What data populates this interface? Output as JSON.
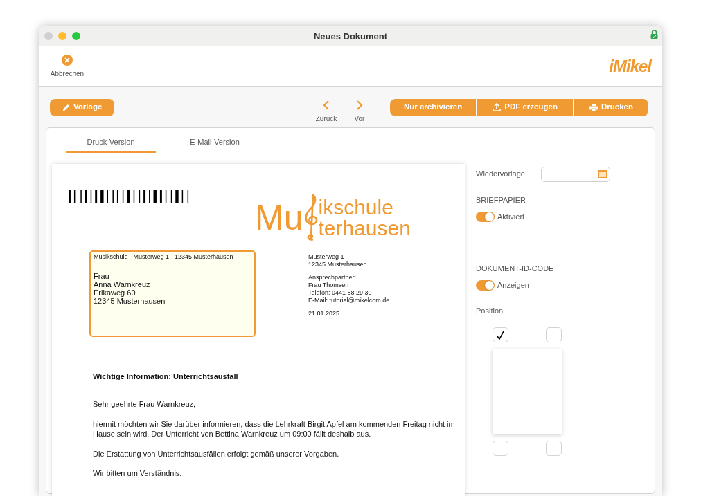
{
  "window": {
    "title": "Neues Dokument"
  },
  "toolbar": {
    "cancel": "Abbrechen",
    "brand": "iMikel"
  },
  "actions": {
    "template": "Vorlage",
    "back": "Zurück",
    "forward": "Vor",
    "buttons": [
      {
        "kind": "archive",
        "label": "Nur archivieren"
      },
      {
        "kind": "pdf",
        "label": "PDF erzeugen"
      },
      {
        "kind": "print",
        "label": "Drucken"
      }
    ]
  },
  "tabs": [
    {
      "label": "Druck-Version",
      "selected": true
    },
    {
      "label": "E-Mail-Version",
      "selected": false
    }
  ],
  "letter": {
    "logo": {
      "lead": "Mu",
      "line_1": "ikschule",
      "line_2": "terhausen"
    },
    "sender_line": "Musikschule - Musterweg 1 - 12345 Musterhausen",
    "recipient": [
      "Frau",
      "Anna Warnkreuz",
      "Erikaweg 60",
      "12345 Musterhausen"
    ],
    "info_blocks": [
      [
        "Musterweg 1",
        "12345 Musterhausen"
      ],
      [
        "Ansprechpartner:",
        "Frau Thomsen",
        "Telefon: 0441 88 29 30",
        "E-Mail: tutorial@mikelcom.de"
      ],
      [
        "21.01.2025"
      ]
    ],
    "subject": "Wichtige Information: Unterrichtsausfall",
    "paragraphs": [
      "Sehr geehrte Frau Warnkreuz,",
      "hiermit möchten wir Sie darüber informieren, dass die Lehrkraft Birgit Apfel am kommenden Freitag nicht im Hause sein wird. Der Unterricht von Bettina Warnkreuz um 09:00 fällt deshalb aus.",
      "Die Erstattung von Unterrichtsausfällen erfolgt gemäß unserer Vorgaben.",
      "Wir bitten um Verständnis."
    ]
  },
  "settings": {
    "follow_up_label": "Wiedervorlage",
    "letterhead": {
      "heading": "BRIEFPAPIER",
      "label": "Aktiviert",
      "on": true
    },
    "id_code": {
      "heading": "DOKUMENT-ID-CODE",
      "label": "Anzeigen",
      "on": true
    },
    "position_label": "Position",
    "positions": [
      {
        "checked": true
      },
      {
        "checked": false
      },
      {
        "checked": false
      },
      {
        "checked": false
      }
    ]
  }
}
